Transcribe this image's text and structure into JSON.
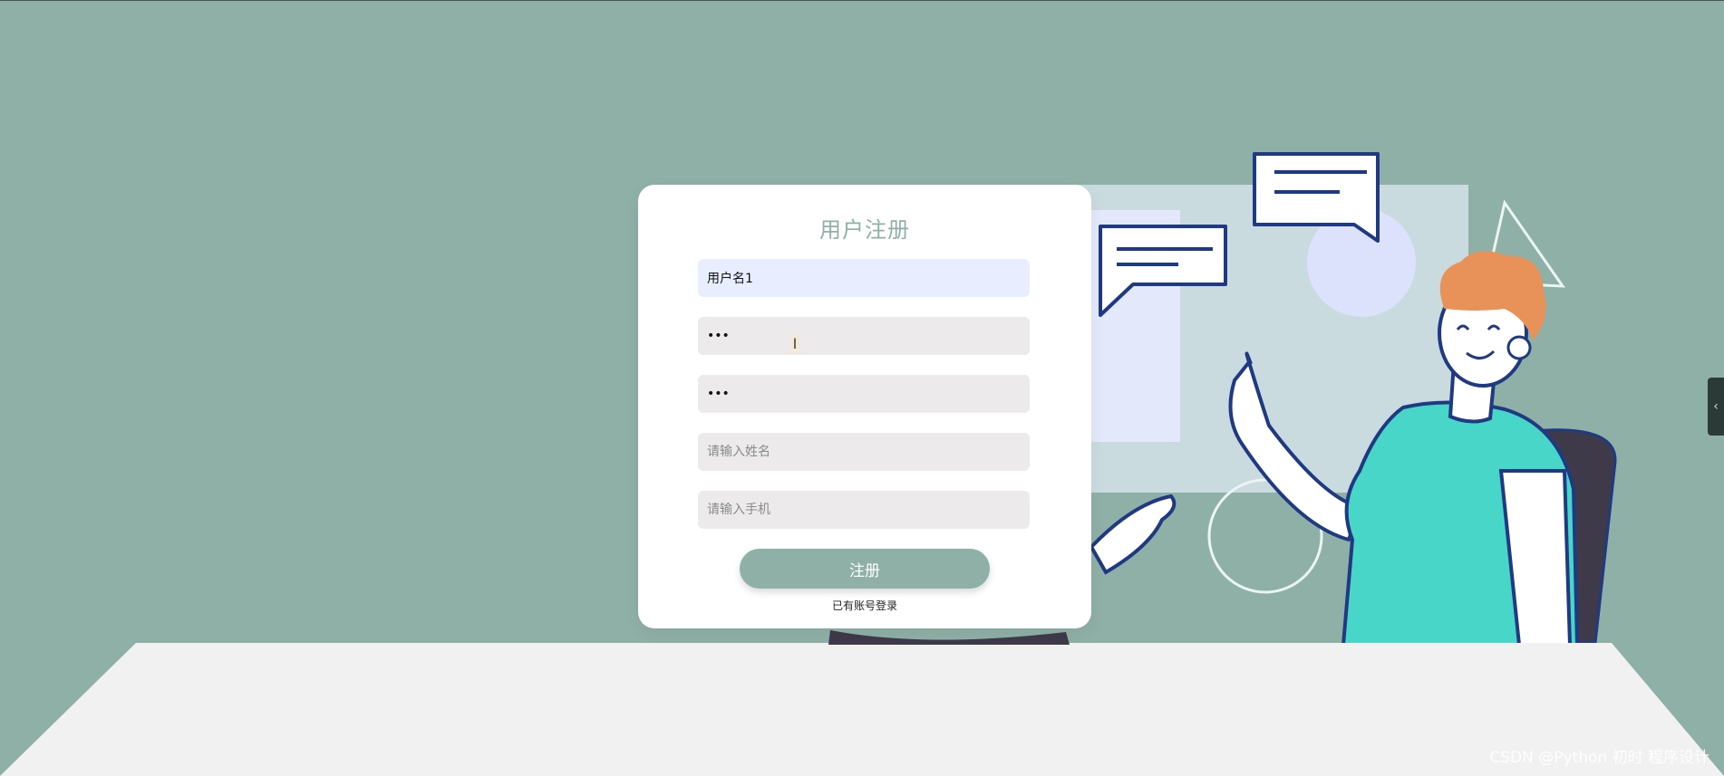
{
  "form": {
    "title": "用户注册",
    "username_value": "用户名1",
    "password_value": "123",
    "confirm_password_value": "123",
    "name_placeholder": "请输入姓名",
    "phone_placeholder": "请输入手机",
    "submit_label": "注册",
    "login_link_label": "已有账号登录"
  },
  "ui": {
    "side_tab_icon": "chevron-left-icon",
    "side_tab_glyph": "‹",
    "cursor_glyph": "I"
  },
  "watermark": "CSDN @Python 初时 程序设计",
  "colors": {
    "background": "#8fb0a7",
    "primary": "#8fb0a7",
    "card": "#ffffff",
    "shirt": "#48d6c8",
    "hair": "#e8925a",
    "outline": "#1f3a82",
    "desk": "#f1f1f2"
  }
}
